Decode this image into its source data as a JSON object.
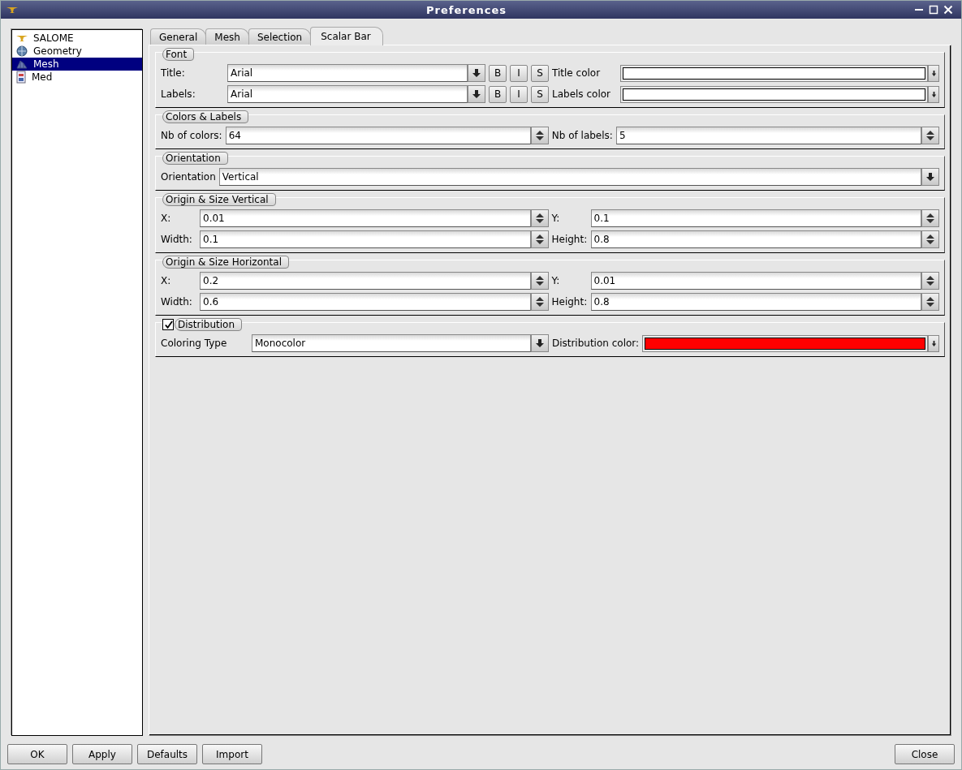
{
  "window": {
    "title": "Preferences"
  },
  "sidebar": {
    "items": [
      {
        "label": "SALOME",
        "kind": "lamp",
        "selected": false
      },
      {
        "label": "Geometry",
        "kind": "globe",
        "selected": false
      },
      {
        "label": "Mesh",
        "kind": "mesh",
        "selected": true
      },
      {
        "label": "Med",
        "kind": "document",
        "selected": false
      }
    ]
  },
  "tabs": [
    {
      "label": "General",
      "selected": false
    },
    {
      "label": "Mesh",
      "selected": false
    },
    {
      "label": "Selection",
      "selected": false
    },
    {
      "label": "Scalar Bar",
      "selected": true
    }
  ],
  "groups": [
    {
      "title": "Font",
      "kind": "font",
      "rows": [
        {
          "items": [
            {
              "kind": "label",
              "text": "Title:"
            },
            {
              "kind": "combo",
              "value": "Arial"
            },
            {
              "kind": "style",
              "text": "B"
            },
            {
              "kind": "style",
              "text": "I"
            },
            {
              "kind": "style",
              "text": "S"
            },
            {
              "kind": "label",
              "text": "Title color"
            },
            {
              "kind": "color",
              "color": "#ffffff"
            }
          ]
        },
        {
          "items": [
            {
              "kind": "label",
              "text": "Labels:"
            },
            {
              "kind": "combo",
              "value": "Arial"
            },
            {
              "kind": "style",
              "text": "B"
            },
            {
              "kind": "style",
              "text": "I"
            },
            {
              "kind": "style",
              "text": "S"
            },
            {
              "kind": "label",
              "text": "Labels color"
            },
            {
              "kind": "color",
              "color": "#ffffff"
            }
          ]
        }
      ]
    },
    {
      "title": "Colors & Labels",
      "kind": "pair",
      "rows": [
        {
          "items": [
            {
              "kind": "label",
              "text": "Nb of colors:"
            },
            {
              "kind": "spin",
              "value": "64"
            },
            {
              "kind": "label",
              "text": "Nb of labels:"
            },
            {
              "kind": "spin",
              "value": "5"
            }
          ]
        }
      ]
    },
    {
      "title": "Orientation",
      "kind": "single",
      "rows": [
        {
          "items": [
            {
              "kind": "label",
              "text": "Orientation"
            },
            {
              "kind": "combo",
              "value": "Vertical"
            }
          ]
        }
      ]
    },
    {
      "title": "Origin & Size Vertical",
      "kind": "pair",
      "rows": [
        {
          "items": [
            {
              "kind": "label",
              "text": "X:"
            },
            {
              "kind": "spin",
              "value": "0.01"
            },
            {
              "kind": "label",
              "text": "Y:"
            },
            {
              "kind": "spin",
              "value": "0.1"
            }
          ]
        },
        {
          "items": [
            {
              "kind": "label",
              "text": "Width:"
            },
            {
              "kind": "spin",
              "value": "0.1"
            },
            {
              "kind": "label",
              "text": "Height:"
            },
            {
              "kind": "spin",
              "value": "0.8"
            }
          ]
        }
      ]
    },
    {
      "title": "Origin & Size Horizontal",
      "kind": "pair",
      "rows": [
        {
          "items": [
            {
              "kind": "label",
              "text": "X:"
            },
            {
              "kind": "spin",
              "value": "0.2"
            },
            {
              "kind": "label",
              "text": "Y:"
            },
            {
              "kind": "spin",
              "value": "0.01"
            }
          ]
        },
        {
          "items": [
            {
              "kind": "label",
              "text": "Width:"
            },
            {
              "kind": "spin",
              "value": "0.6"
            },
            {
              "kind": "label",
              "text": "Height:"
            },
            {
              "kind": "spin",
              "value": "0.8"
            }
          ]
        }
      ]
    },
    {
      "title": "Distribution",
      "kind": "distribution",
      "checked": true,
      "rows": [
        {
          "items": [
            {
              "kind": "label",
              "text": "Coloring Type"
            },
            {
              "kind": "combo",
              "value": "Monocolor"
            },
            {
              "kind": "label",
              "text": "Distribution color:"
            },
            {
              "kind": "color",
              "color": "#ff0000"
            }
          ]
        }
      ]
    }
  ],
  "buttons_left": [
    "OK",
    "Apply",
    "Defaults",
    "Import"
  ],
  "buttons_right": [
    "Close"
  ]
}
